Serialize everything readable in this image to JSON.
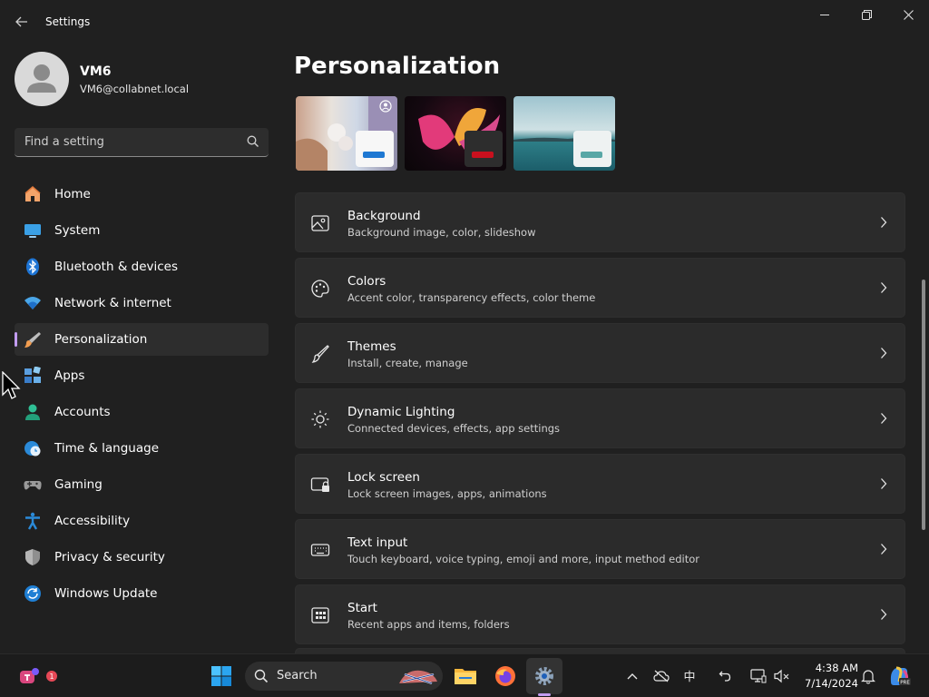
{
  "window": {
    "app_title": "Settings",
    "back_icon": "back-arrow-icon",
    "controls": [
      "minimize-icon",
      "maximize-icon",
      "close-icon"
    ]
  },
  "profile": {
    "name": "VM6",
    "email": "VM6@collabnet.local",
    "avatar_icon": "person-icon"
  },
  "search": {
    "placeholder": "Find a setting",
    "icon": "search-icon"
  },
  "sidebar": {
    "selected_index": 4,
    "accent": "#c29cf0",
    "items": [
      {
        "label": "Home",
        "icon": "home-icon"
      },
      {
        "label": "System",
        "icon": "monitor-icon"
      },
      {
        "label": "Bluetooth & devices",
        "icon": "bluetooth-icon"
      },
      {
        "label": "Network & internet",
        "icon": "wifi-icon"
      },
      {
        "label": "Personalization",
        "icon": "paintbrush-icon"
      },
      {
        "label": "Apps",
        "icon": "apps-icon"
      },
      {
        "label": "Accounts",
        "icon": "account-icon"
      },
      {
        "label": "Time & language",
        "icon": "globe-clock-icon"
      },
      {
        "label": "Gaming",
        "icon": "gamepad-icon"
      },
      {
        "label": "Accessibility",
        "icon": "accessibility-icon"
      },
      {
        "label": "Privacy & security",
        "icon": "shield-icon"
      },
      {
        "label": "Windows Update",
        "icon": "update-icon"
      }
    ]
  },
  "main": {
    "title": "Personalization",
    "themes": [
      {
        "name": "theme-beach-flowers",
        "accent": "#1e78d2"
      },
      {
        "name": "theme-glow",
        "accent": "#c8101e"
      },
      {
        "name": "theme-lake",
        "accent": "#58a7a6"
      }
    ],
    "cards": [
      {
        "title": "Background",
        "subtitle": "Background image, color, slideshow",
        "icon": "image-icon"
      },
      {
        "title": "Colors",
        "subtitle": "Accent color, transparency effects, color theme",
        "icon": "palette-icon"
      },
      {
        "title": "Themes",
        "subtitle": "Install, create, manage",
        "icon": "brush-icon"
      },
      {
        "title": "Dynamic Lighting",
        "subtitle": "Connected devices, effects, app settings",
        "icon": "lighting-icon"
      },
      {
        "title": "Lock screen",
        "subtitle": "Lock screen images, apps, animations",
        "icon": "lock-screen-icon"
      },
      {
        "title": "Text input",
        "subtitle": "Touch keyboard, voice typing, emoji and more, input method editor",
        "icon": "keyboard-icon"
      },
      {
        "title": "Start",
        "subtitle": "Recent apps and items, folders",
        "icon": "start-menu-icon"
      }
    ]
  },
  "taskbar": {
    "search_label": "Search",
    "notification_badge": "1",
    "ime_label": "中",
    "clock_time": "4:38 AM",
    "clock_date": "7/14/2024",
    "icons": [
      "teams-icon",
      "windows-start-icon",
      "search-icon",
      "file-explorer-icon",
      "firefox-icon",
      "settings-icon",
      "chevron-up-icon",
      "cloud-offline-icon",
      "ime-icon",
      "undo-icon",
      "display-icon",
      "speaker-muted-icon",
      "notification-bell-icon",
      "copilot-icon"
    ]
  }
}
